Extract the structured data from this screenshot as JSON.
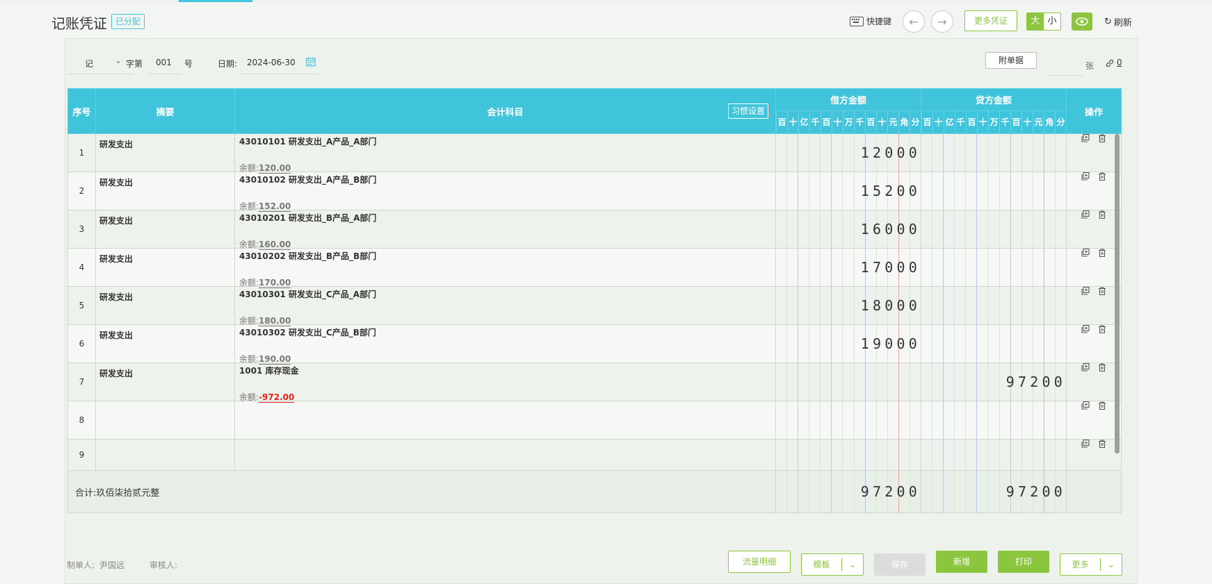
{
  "header": {
    "title": "记账凭证",
    "status_badge": "已分配",
    "shortcut_label": "快捷键",
    "more_vouchers": "更多凭证",
    "size_big": "大",
    "size_small": "小",
    "refresh": "刷新"
  },
  "voucher_info": {
    "word": "记",
    "word_suffix": "字第",
    "number": "001",
    "number_suffix": "号",
    "date_label": "日期:",
    "date": "2024-06-30",
    "attachment_button": "附单据",
    "attachment_unit": "张",
    "attachment_count": "0"
  },
  "table": {
    "headers": {
      "seq": "序号",
      "summary": "摘要",
      "account": "会计科目",
      "habit_settings": "习惯设置",
      "debit": "借方金额",
      "credit": "贷方金额",
      "ops": "操作"
    },
    "digit_units": [
      "百",
      "十",
      "亿",
      "千",
      "百",
      "十",
      "万",
      "千",
      "百",
      "十",
      "元",
      "角",
      "分"
    ],
    "balance_label": "余额:",
    "rows": [
      {
        "seq": "1",
        "summary": "研发支出",
        "account": "43010101 研发支出_A产品_A部门",
        "balance": "120.00",
        "debit": "12000",
        "credit": ""
      },
      {
        "seq": "2",
        "summary": "研发支出",
        "account": "43010102 研发支出_A产品_B部门",
        "balance": "152.00",
        "debit": "15200",
        "credit": ""
      },
      {
        "seq": "3",
        "summary": "研发支出",
        "account": "43010201 研发支出_B产品_A部门",
        "balance": "160.00",
        "debit": "16000",
        "credit": ""
      },
      {
        "seq": "4",
        "summary": "研发支出",
        "account": "43010202 研发支出_B产品_B部门",
        "balance": "170.00",
        "debit": "17000",
        "credit": ""
      },
      {
        "seq": "5",
        "summary": "研发支出",
        "account": "43010301 研发支出_C产品_A部门",
        "balance": "180.00",
        "debit": "18000",
        "credit": ""
      },
      {
        "seq": "6",
        "summary": "研发支出",
        "account": "43010302 研发支出_C产品_B部门",
        "balance": "190.00",
        "debit": "19000",
        "credit": ""
      },
      {
        "seq": "7",
        "summary": "研发支出",
        "account": "1001 库存现金",
        "balance": "-972.00",
        "debit": "",
        "credit": "97200"
      },
      {
        "seq": "8",
        "summary": "",
        "account": "",
        "balance": "",
        "debit": "",
        "credit": ""
      },
      {
        "seq": "9",
        "summary": "",
        "account": "",
        "balance": "",
        "debit": "",
        "credit": ""
      }
    ],
    "total_label": "合计:玖佰柒拾贰元整",
    "total_debit": "97200",
    "total_credit": "97200"
  },
  "footer": {
    "maker_label": "制单人:",
    "maker": "尹国远",
    "reviewer_label": "审核人:",
    "flow_detail": "流量明细",
    "template": "模板",
    "save": "保存",
    "new": "新增",
    "print": "打印",
    "more": "更多"
  },
  "colors": {
    "accent": "#8cc63f",
    "table_header": "#3fc4dc",
    "negative": "#e02020"
  }
}
